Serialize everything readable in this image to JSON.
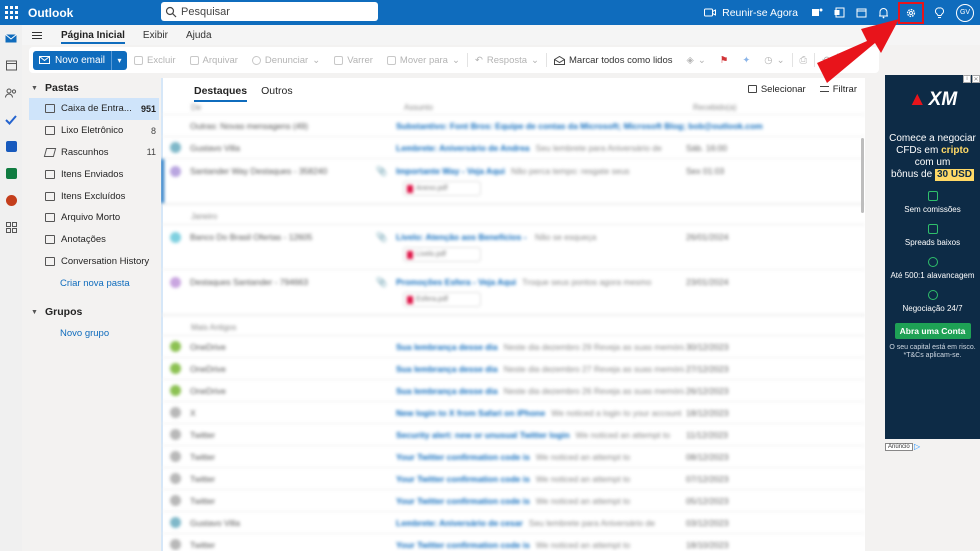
{
  "app": {
    "title": "Outlook"
  },
  "search": {
    "placeholder": "Pesquisar"
  },
  "topbar": {
    "meet_label": "Reunir-se Agora",
    "avatar_initials": "GV",
    "accent": "#0f6cbd",
    "highlight": "#e8141b"
  },
  "menu": {
    "tabs": [
      "Página Inicial",
      "Exibir",
      "Ajuda"
    ]
  },
  "ribbon": {
    "new_mail": "Novo email",
    "buttons": [
      "Excluir",
      "Arquivar",
      "Denunciar",
      "Varrer",
      "Mover para",
      "Resposta",
      "Marcar todos como lidos"
    ]
  },
  "folders": {
    "section_title": "Pastas",
    "items": [
      {
        "label": "Caixa de Entra...",
        "count": "951"
      },
      {
        "label": "Lixo Eletrônico",
        "count": "8"
      },
      {
        "label": "Rascunhos",
        "count": "11"
      },
      {
        "label": "Itens Enviados",
        "count": ""
      },
      {
        "label": "Itens Excluídos",
        "count": ""
      },
      {
        "label": "Arquivo Morto",
        "count": ""
      },
      {
        "label": "Anotações",
        "count": ""
      },
      {
        "label": "Conversation History",
        "count": ""
      }
    ],
    "create_folder": "Criar nova pasta",
    "groups_title": "Grupos",
    "new_group": "Novo grupo"
  },
  "list": {
    "tabs": [
      "Destaques",
      "Outros"
    ],
    "select_label": "Selecionar",
    "filter_label": "Filtrar",
    "columns": [
      "De",
      "Assunto",
      "Recebido(a)"
    ],
    "groups": [
      "Janeiro",
      "Mais Antigos"
    ],
    "rows": [
      {
        "from": "Outras: Novas mensagens (49)",
        "subject": "Substantivo: Font Bros: Equipe de contas da Microsoft; Microsoft Blog; bob@outlook.com",
        "preview": "",
        "date": ""
      },
      {
        "from": "Gustavo Villa",
        "subject": "Lembrete: Aniversário de Andrea",
        "preview": "Seu lembrete para Aniversário de",
        "date": "Sáb. 16:00"
      },
      {
        "from": "Santander Way Destaques - 358240",
        "subject": "Importante Way - Veja Aqui",
        "preview": "Não perca tempo: resgate seus",
        "date": "Sex 01:03",
        "attachment": "Anexo.pdf"
      },
      {
        "from": "Banco Do Brasil Ofertas - 12605",
        "subject": "Livelo: Atenção aos Benefícios - ",
        "preview": "Não se esqueça",
        "date": "26/01/2024",
        "attachment": "Livelo.pdf"
      },
      {
        "from": "Destaques Santander - 794663",
        "subject": "Promoções Esfera - Veja Aqui",
        "preview": "Troque seus pontos agora mesmo",
        "date": "23/01/2024",
        "attachment": "Esfera.pdf"
      },
      {
        "from": "OneDrive",
        "subject": "Sua lembrança desse dia",
        "preview": "Neste dia dezembro 29 Reveja as suas memórias",
        "date": "30/12/2023"
      },
      {
        "from": "OneDrive",
        "subject": "Sua lembrança desse dia",
        "preview": "Neste dia dezembro 27 Reveja as suas memórias",
        "date": "27/12/2023"
      },
      {
        "from": "OneDrive",
        "subject": "Sua lembrança desse dia",
        "preview": "Neste dia dezembro 26 Reveja as suas memórias",
        "date": "26/12/2023"
      },
      {
        "from": "X",
        "subject": "New login to X from Safari on iPhone",
        "preview": "We noticed a login to your account",
        "date": "18/12/2023"
      },
      {
        "from": "Twitter",
        "subject": "Security alert: new or unusual Twitter login",
        "preview": "We noticed an attempt to",
        "date": "11/12/2023"
      },
      {
        "from": "Twitter",
        "subject": "Your Twitter confirmation code is",
        "preview": "We noticed an attempt to",
        "date": "08/12/2023"
      },
      {
        "from": "Twitter",
        "subject": "Your Twitter confirmation code is",
        "preview": "We noticed an attempt to",
        "date": "07/12/2023"
      },
      {
        "from": "Twitter",
        "subject": "Your Twitter confirmation code is",
        "preview": "We noticed an attempt to",
        "date": "05/12/2023"
      },
      {
        "from": "Gustavo Villa",
        "subject": "Lembrete: Aniversário de cesar",
        "preview": "Seu lembrete para Aniversário de",
        "date": "03/12/2023"
      },
      {
        "from": "Twitter",
        "subject": "Your Twitter confirmation code is",
        "preview": "We noticed an attempt to",
        "date": "18/10/2023"
      }
    ]
  },
  "ad": {
    "logo": "XM",
    "headline_1": "Comece a negociar",
    "headline_2": "CFDs em",
    "headline_hl": "cripto",
    "headline_3": "com um",
    "headline_4": "bônus de",
    "bonus": "30 USD",
    "features": [
      "Sem comissões",
      "Spreads baixos",
      "Até 500:1 alavancagem",
      "Negociação 24/7"
    ],
    "cta": "Abra uma Conta",
    "risk": "O seu capital está em risco. *T&Cs aplicam-se.",
    "tag": "Anúncio"
  }
}
